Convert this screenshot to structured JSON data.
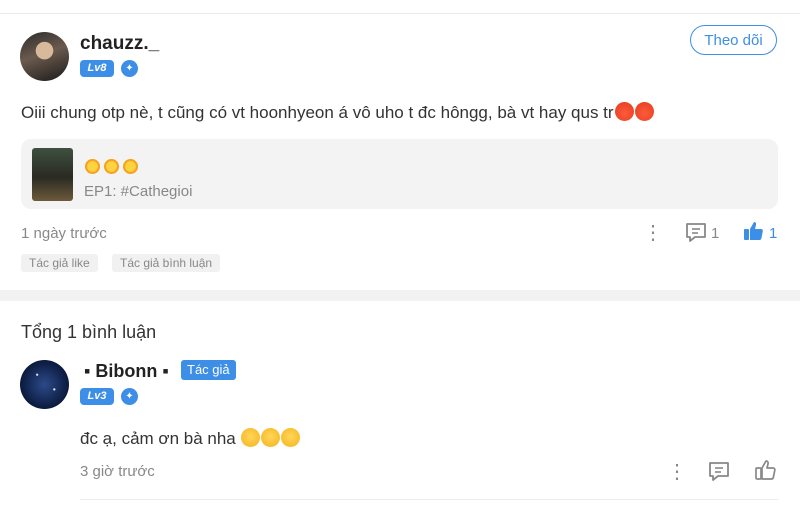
{
  "post": {
    "username": "chauzz._",
    "level": "Lv8",
    "follow_label": "Theo dõi",
    "text": "Oiii chung otp nè, t cũng có vt hoonhyeon á vô uho t đc hôngg, bà vt hay qus tr",
    "emojis": [
      "angry-face",
      "angry-face"
    ],
    "card": {
      "episode": "EP1: #Cathegioi",
      "icons": [
        "sun",
        "sun",
        "sun"
      ]
    },
    "time": "1 ngày trước",
    "reply_count": "1",
    "like_count": "1",
    "tags": [
      "Tác giả like",
      "Tác giả bình luận"
    ]
  },
  "replies": {
    "total_label": "Tổng 1 bình luận",
    "items": [
      {
        "username": "▪ Bibonn ▪",
        "author_badge": "Tác giả",
        "level": "Lv3",
        "text": "đc ạ, cảm ơn bà nha",
        "emojis": [
          "smiling-face",
          "grinning-face",
          "smiling-face-with-hearts"
        ],
        "time": "3 giờ trước"
      }
    ]
  },
  "colors": {
    "accent": "#3d8ee6",
    "muted": "#888888",
    "text": "#333333"
  }
}
